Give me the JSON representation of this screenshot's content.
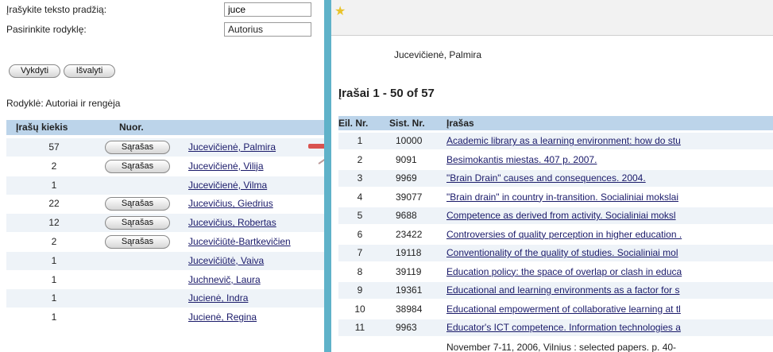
{
  "search": {
    "start_label": "Įrašykite teksto pradžią:",
    "start_value": "juce",
    "index_label": "Pasirinkite rodyklę:",
    "index_value": "Autorius",
    "execute_label": "Vykdyti",
    "clear_label": "Išvalyti",
    "index_caption": "Rodyklė: Autoriai ir rengėja"
  },
  "left_table": {
    "headers": [
      "Įrašų kiekis",
      "Nuor.",
      ""
    ],
    "list_button_label": "Sąrašas",
    "rows": [
      {
        "count": "57",
        "has_list": true,
        "author": "Jucevičienė, Palmira"
      },
      {
        "count": "2",
        "has_list": true,
        "author": "Jucevičienė, Vilija"
      },
      {
        "count": "1",
        "has_list": false,
        "author": "Jucevičienė, Vilma"
      },
      {
        "count": "22",
        "has_list": true,
        "author": "Jucevičius, Giedrius"
      },
      {
        "count": "12",
        "has_list": true,
        "author": "Jucevičius, Robertas"
      },
      {
        "count": "2",
        "has_list": true,
        "author": "Jucevičiūtė-Bartkevičien"
      },
      {
        "count": "1",
        "has_list": false,
        "author": "Jucevičiūtė, Vaiva"
      },
      {
        "count": "1",
        "has_list": false,
        "author": "Juchnevič, Laura"
      },
      {
        "count": "1",
        "has_list": false,
        "author": "Jucienė, Indra"
      },
      {
        "count": "1",
        "has_list": false,
        "author": "Jucienė, Regina"
      }
    ]
  },
  "results": {
    "author": "Jucevičienė, Palmira",
    "range_title": "Įrašai 1 - 50 of 57",
    "headers": [
      "Eil. Nr.",
      "Sist. Nr.",
      "Įrašas"
    ],
    "rows": [
      {
        "n": "1",
        "id": "10000",
        "title": "Academic library as a learning environment: how do stu"
      },
      {
        "n": "2",
        "id": "9091",
        "title": "Besimokantis miestas.  407 p.  2007."
      },
      {
        "n": "3",
        "id": "9969",
        "title": "\"Brain Drain\" causes and consequences.  2004."
      },
      {
        "n": "4",
        "id": "39077",
        "title": "\"Brain drain\" in country in-transition.  Socialiniai mokslai"
      },
      {
        "n": "5",
        "id": "9688",
        "title": "Competence as derived from activity.  Socialiniai moksl"
      },
      {
        "n": "6",
        "id": "23422",
        "title": "Controversies of quality perception in higher education ."
      },
      {
        "n": "7",
        "id": "19118",
        "title": "Conventionality of the quality of studies.  Socialiniai mol"
      },
      {
        "n": "8",
        "id": "39119",
        "title": "Education policy: the space of overlap or clash in educa"
      },
      {
        "n": "9",
        "id": "19361",
        "title": "Educational and learning environments as a factor for s"
      },
      {
        "n": "10",
        "id": "38984",
        "title": "Educational empowerment of collaborative learning at tl"
      },
      {
        "n": "11",
        "id": "9963",
        "title": "Educator's ICT competence.  Information technologies a"
      }
    ],
    "extra_line": "November 7-11, 2006, Vilnius : selected papers.  p. 40-"
  },
  "colors": {
    "header_bg": "#bcd4ea",
    "divider": "#5fb2c9",
    "link": "#1a1a6a"
  }
}
